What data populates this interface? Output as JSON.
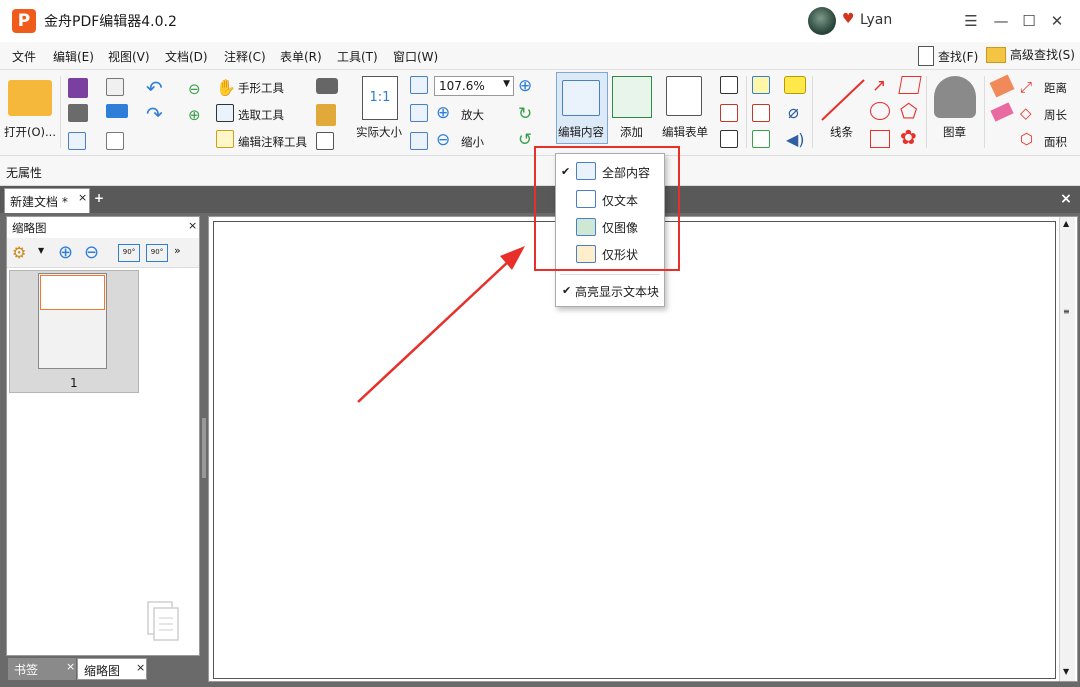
{
  "app": {
    "logo_letter": "P",
    "title": "金舟PDF编辑器4.0.2",
    "user": "Lyan"
  },
  "window_controls": {
    "menu": "☰",
    "minimize": "—",
    "maximize": "☐",
    "close": "✕"
  },
  "menu": [
    "文件",
    "编辑(E)",
    "视图(V)",
    "文档(D)",
    "注释(C)",
    "表单(R)",
    "工具(T)",
    "窗口(W)"
  ],
  "search": {
    "find": "查找(F)",
    "advanced_find": "高级查找(S)"
  },
  "ribbon": {
    "open": "打开(O)...",
    "hand_tool": "手形工具",
    "select_tool": "选取工具",
    "edit_annot_tool": "编辑注释工具",
    "actual_size": "实际大小",
    "zoom_value": "107.6%",
    "zoom_in": "放大",
    "zoom_out": "缩小",
    "edit_content": "编辑内容",
    "add": "添加",
    "edit_form": "编辑表单",
    "line": "线条",
    "stamp": "图章",
    "distance": "距离",
    "perimeter": "周长",
    "area": "面积"
  },
  "properties": "无属性",
  "tabs": {
    "doc": "新建文档 *",
    "close": "×",
    "new": "+",
    "close_all": "×"
  },
  "panel": {
    "title": "缩略图",
    "close": "×",
    "page_number": "1",
    "rotate_left": "90°",
    "rotate_right": "90°"
  },
  "bottom_tabs": {
    "bookmark": "书签",
    "thumbs": "缩略图",
    "close": "×"
  },
  "dropdown": {
    "items": [
      "全部内容",
      "仅文本",
      "仅图像",
      "仅形状"
    ],
    "highlight": "高亮显示文本块",
    "checked": "✔"
  },
  "colors": {
    "accent": "#f05a1a",
    "annotation_red": "#e8302a",
    "icon_blue": "#4a7fc4"
  }
}
